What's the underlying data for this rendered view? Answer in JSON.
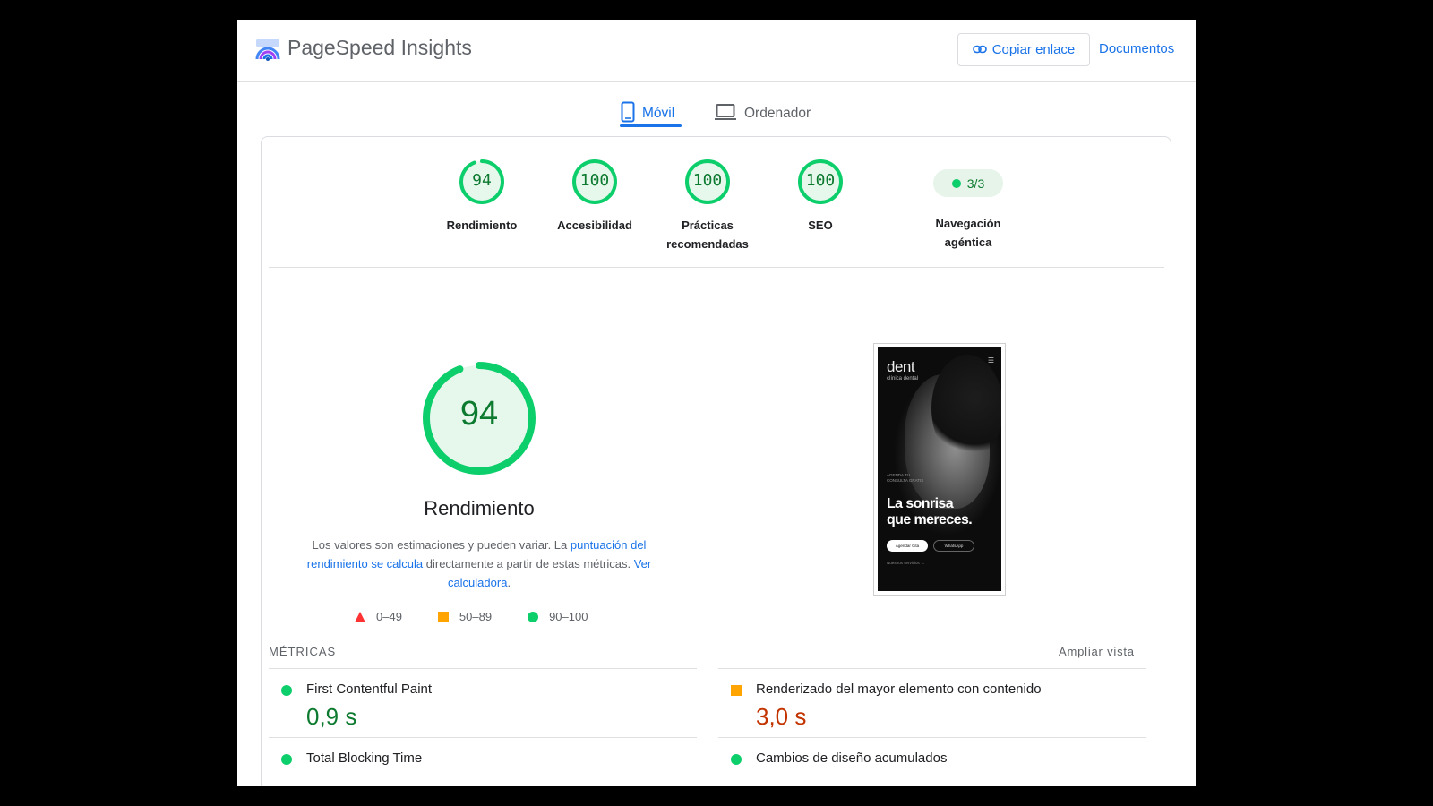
{
  "app": {
    "title": "PageSpeed Insights"
  },
  "header": {
    "copy_link": "Copiar enlace",
    "docs": "Documentos"
  },
  "tabs": [
    {
      "label": "Móvil",
      "active": true
    },
    {
      "label": "Ordenador",
      "active": false
    }
  ],
  "categories": [
    {
      "score": "94",
      "label": "Rendimiento"
    },
    {
      "score": "100",
      "label": "Accesibilidad"
    },
    {
      "score": "100",
      "label": "Prácticas recomendadas"
    },
    {
      "score": "100",
      "label": "SEO"
    }
  ],
  "agentic": {
    "value": "3/3",
    "label": "Navegación agéntica"
  },
  "performance": {
    "score": "94",
    "score_fraction": 0.94,
    "title": "Rendimiento",
    "desc_1": "Los valores son estimaciones y pueden variar. La ",
    "desc_link_1": "puntuación del rendimiento se calcula",
    "desc_2": " directamente a partir de estas métricas. ",
    "desc_link_2": "Ver calculadora",
    "desc_3": "."
  },
  "legend": [
    {
      "range": "0–49",
      "icon": "red-triangle-icon"
    },
    {
      "range": "50–89",
      "icon": "orange-square-icon"
    },
    {
      "range": "90–100",
      "icon": "green-circle-icon"
    }
  ],
  "screenshot": {
    "logo": "dent",
    "sub": "clínica dental",
    "small_text": "AGENDA TU CONSULTA GRATIS",
    "headline_1": "La sonrisa",
    "headline_2": "que mereces.",
    "btn_1": "Agendar Cita",
    "btn_2": "WhatsApp",
    "link": "Nuestros servicios →"
  },
  "metrics": {
    "title": "MÉTRICAS",
    "expand": "Ampliar vista",
    "items": [
      {
        "name": "First Contentful Paint",
        "value": "0,9 s",
        "rating": "good"
      },
      {
        "name": "Renderizado del mayor elemento con contenido",
        "value": "3,0 s",
        "rating": "average"
      },
      {
        "name": "Total Blocking Time",
        "value": "",
        "rating": "good"
      },
      {
        "name": "Cambios de diseño acumulados",
        "value": "",
        "rating": "good"
      }
    ]
  },
  "colors": {
    "accent": "#1a73e8",
    "good": "#0cce6b",
    "good_text": "#0c7a2f",
    "average": "#ffa400",
    "poor": "#ff3333"
  }
}
